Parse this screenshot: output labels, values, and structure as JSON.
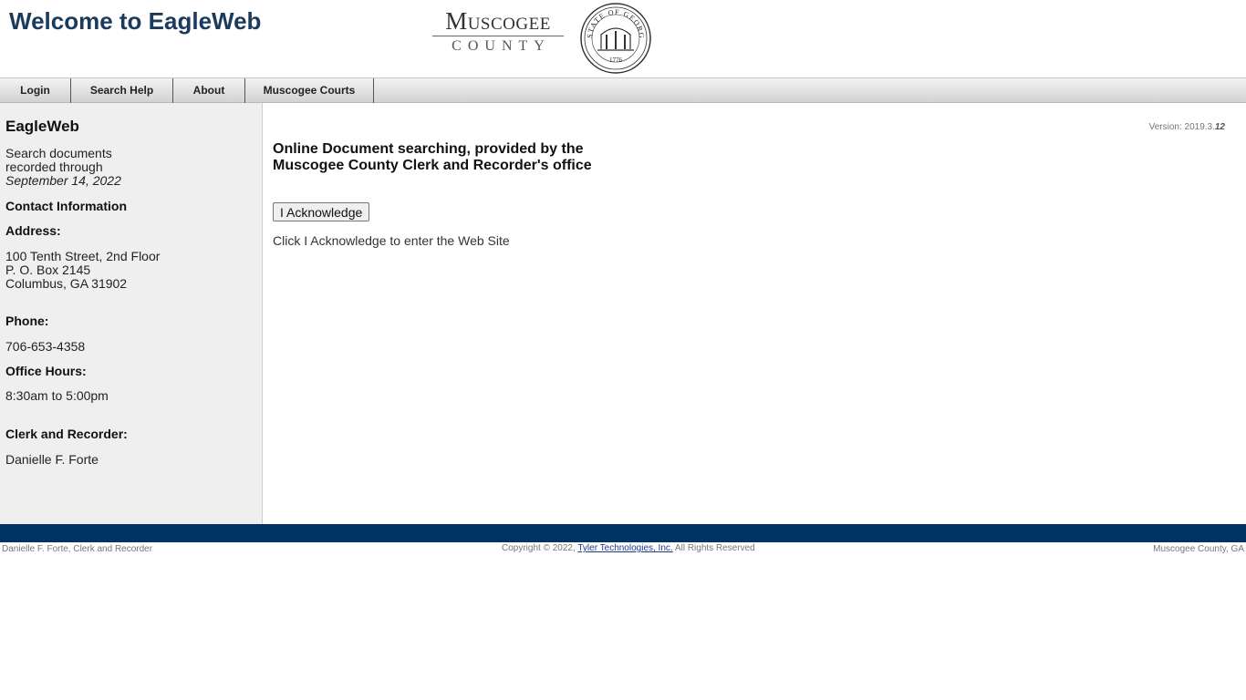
{
  "header": {
    "title": "Welcome to EagleWeb",
    "logo_name": "Muscogee",
    "logo_sub": "COUNTY",
    "seal_text": "STATE OF GEORGIA",
    "seal_year": "1776"
  },
  "nav": {
    "items": [
      {
        "label": "Login"
      },
      {
        "label": "Search Help"
      },
      {
        "label": "About"
      },
      {
        "label": "Muscogee Courts"
      }
    ]
  },
  "sidebar": {
    "title": "EagleWeb",
    "search_line1": "Search documents",
    "search_line2": "recorded through",
    "search_date": "September 14, 2022",
    "contact_heading": "Contact Information",
    "address_heading": "Address:",
    "address_lines": [
      "100 Tenth Street, 2nd Floor",
      "P. O. Box 2145",
      "Columbus, GA 31902"
    ],
    "phone_heading": "Phone:",
    "phone": "706-653-4358",
    "hours_heading": "Office Hours:",
    "hours": "8:30am to 5:00pm",
    "clerk_heading": "Clerk and Recorder:",
    "clerk_name": "Danielle F. Forte"
  },
  "main": {
    "version_prefix": "Version: 2019.3.",
    "version_build": "12",
    "heading_line1": "Online Document searching, provided by the",
    "heading_line2": "Muscogee County Clerk and Recorder's office",
    "ack_button": "I Acknowledge",
    "ack_hint": "Click I Acknowledge to enter the Web Site"
  },
  "footer": {
    "left": "Danielle F. Forte, Clerk and Recorder",
    "copyright_prefix": "Copyright © 2022,",
    "company_link": "Tyler Technologies, Inc.",
    "copyright_suffix": "All Rights Reserved",
    "right": "Muscogee County, GA"
  },
  "colors": {
    "title": "#1b3a5c",
    "footer_bar": "#003366",
    "sidebar_bg": "#efefef"
  }
}
